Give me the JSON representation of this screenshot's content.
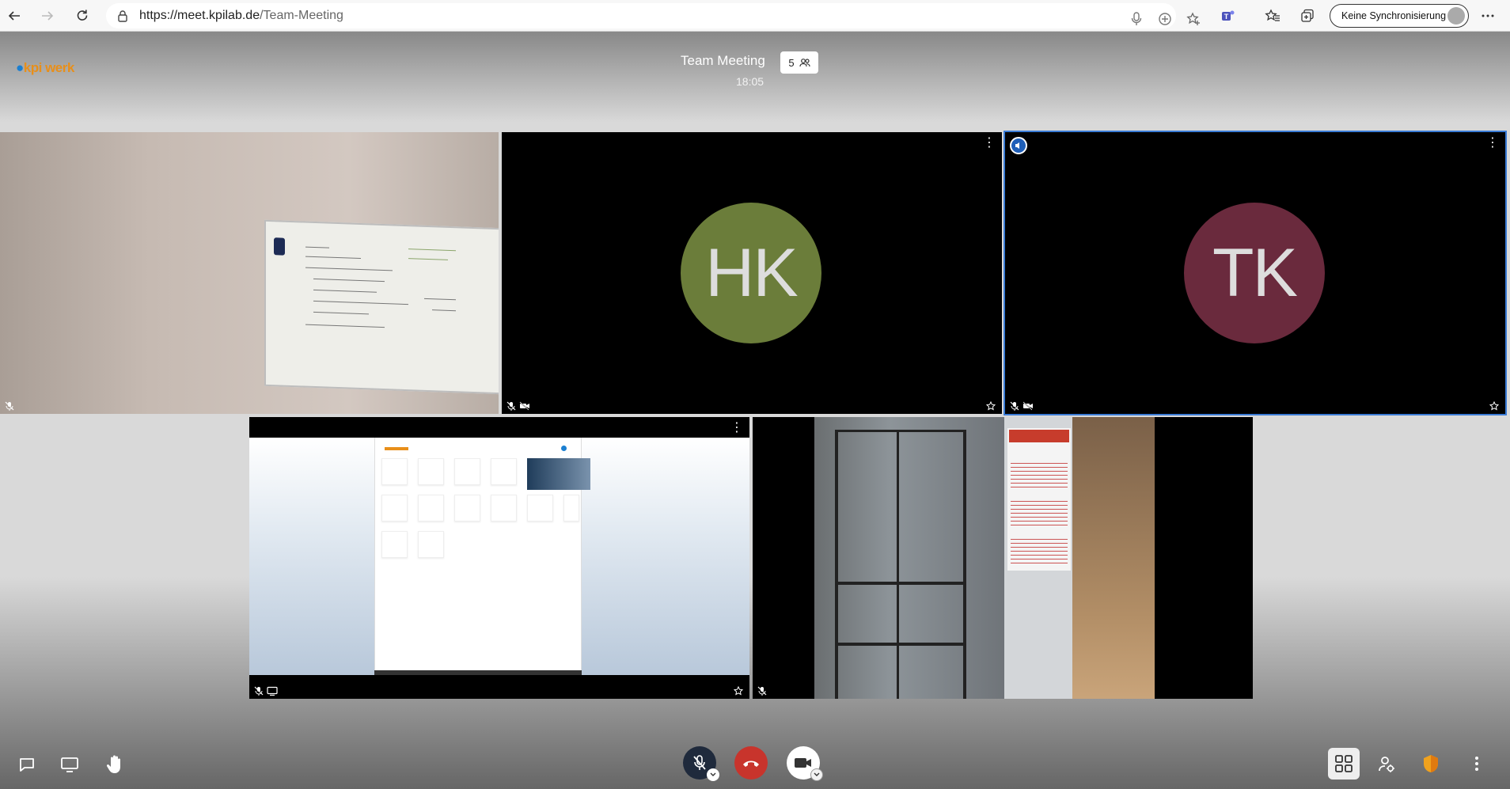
{
  "browser": {
    "url_host": "https://meet.kpilab.de",
    "url_path": "/Team-Meeting",
    "sync_label": "Keine Synchronisierung"
  },
  "meeting": {
    "logo": "kpi werk",
    "title": "Team Meeting",
    "participant_count": "5",
    "time": "18:05"
  },
  "participants": [
    {
      "initials": "",
      "video": "webcam-whiteboard",
      "muted": true
    },
    {
      "initials": "HK",
      "color": "#6b7d3a",
      "muted": true,
      "video_off": true
    },
    {
      "initials": "TK",
      "color": "#6a2a3d",
      "muted": true,
      "video_off": true,
      "dominant_speaker": true
    },
    {
      "initials": "",
      "video": "screen-share",
      "muted": true
    },
    {
      "initials": "",
      "video": "webcam-room",
      "muted": true
    }
  ],
  "colors": {
    "accent": "#3a7bd5",
    "hangup": "#c8342c",
    "mic_muted": "#1f2a3c",
    "shield": "#f0a21e"
  },
  "toolbar": {
    "left": [
      "chat-icon",
      "screenshare-icon",
      "raise-hand-icon"
    ],
    "center": [
      "mic-muted-icon",
      "hangup-icon",
      "camera-icon"
    ],
    "right": [
      "tile-view-icon",
      "participants-icon",
      "security-shield-icon",
      "more-icon"
    ]
  }
}
